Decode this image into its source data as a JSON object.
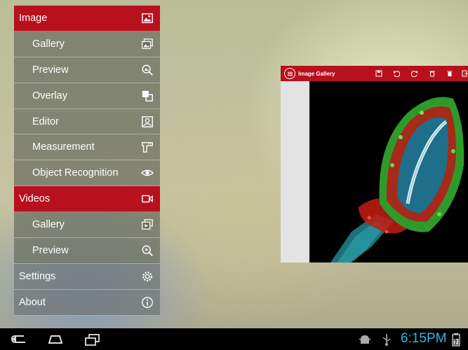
{
  "menu": {
    "image_header": "Image",
    "image_items": [
      "Gallery",
      "Preview",
      "Overlay",
      "Editor",
      "Measurement",
      "Object Recognition"
    ],
    "videos_header": "Videos",
    "video_items": [
      "Gallery",
      "Preview"
    ],
    "settings": "Settings",
    "about": "About"
  },
  "gallery": {
    "title": "Image Gallery",
    "toolbar_icons": [
      "save-icon",
      "rotate-left-icon",
      "rotate-right-icon",
      "delete-icon",
      "delete-all-icon",
      "exit-icon"
    ]
  },
  "statusbar": {
    "time": "6:15PM",
    "icons": [
      "android-debug-icon",
      "usb-icon",
      "battery-icon"
    ]
  },
  "colors": {
    "accent": "#b8101d",
    "clock": "#33b5e5"
  }
}
